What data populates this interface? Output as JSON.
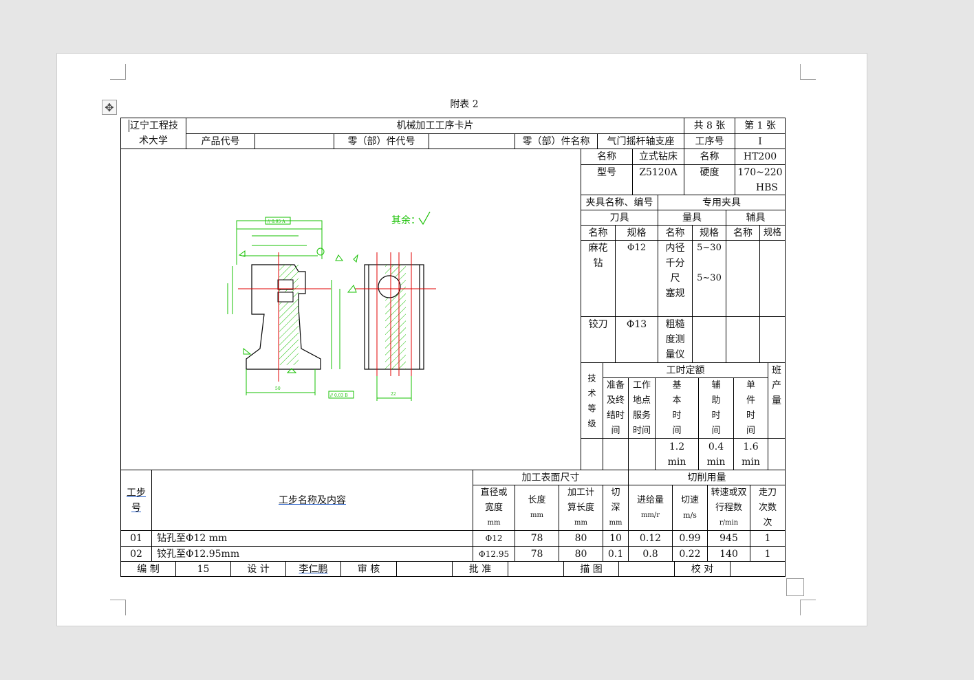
{
  "document": {
    "caption": "附表 2",
    "school": [
      "辽宁工程技",
      "术大学"
    ],
    "card_title": "机械加工工序卡片",
    "sheet_total": "共 8 张",
    "sheet_no": "第 1 张",
    "product_code_label": "产品代号",
    "product_code_value": "",
    "part_code_label": "零（部）件代号",
    "part_code_value": "",
    "part_name_label": "零（部）件名称",
    "part_name_value": "气门摇杆轴支座",
    "process_no_label": "工序号",
    "process_no_value": "I"
  },
  "machine": {
    "name_label": "名称",
    "name_value": "立式钻床",
    "model_label": "型号",
    "model_value": "Z5120A"
  },
  "material": {
    "name_label": "名称",
    "name_value": "HT200",
    "hardness_label": "硬度",
    "hardness_value": [
      "170~220",
      "HBS"
    ]
  },
  "fixture": {
    "label": "夹具名称、编号",
    "value": "专用夹具"
  },
  "tools": {
    "cutter": "刀具",
    "gauge": "量具",
    "aux": "辅具",
    "name": "名称",
    "spec": "规格",
    "spec_aux": "规格",
    "rows": [
      {
        "cutter_name": [
          "麻花",
          "钻"
        ],
        "cutter_spec": "Φ12",
        "gauge_name": [
          "内径",
          "千分",
          "尺",
          "塞规"
        ],
        "gauge_spec": [
          "5~30",
          "",
          "5~30"
        ]
      },
      {
        "cutter_name": [
          "铰刀"
        ],
        "cutter_spec": "Φ13",
        "gauge_name": [
          "粗糙",
          "度测",
          "量仪"
        ],
        "gauge_spec": []
      }
    ]
  },
  "time": {
    "tech_grade": [
      "技",
      "术",
      "等",
      "级"
    ],
    "quota": "工时定额",
    "output": [
      "班",
      "产",
      "量"
    ],
    "prep": [
      "准备",
      "及终",
      "结时",
      "间"
    ],
    "service": [
      "工作",
      "地点",
      "服务",
      "时间"
    ],
    "basic": [
      "基",
      "本",
      "时",
      "间"
    ],
    "auxiliary": [
      "辅",
      "助",
      "时",
      "间"
    ],
    "unit": [
      "单",
      "件",
      "时",
      "间"
    ],
    "basic_value": [
      "1.2",
      "min"
    ],
    "aux_value": [
      "0.4",
      "min"
    ],
    "unit_value": [
      "1.6",
      "min"
    ]
  },
  "drawing": {
    "rest": "其余：",
    "gdt1": "// 0.05 A",
    "gdt2": "// 0.03 B",
    "dim_bottom1": "50",
    "dim_bottom2": "22"
  },
  "steps": {
    "no_label": [
      "工步",
      "号"
    ],
    "content_label": "工步名称及内容",
    "surface_label": "加工表面尺寸",
    "cutting_label": "切削用量",
    "diameter_label": [
      "直径或",
      "宽度",
      "mm"
    ],
    "length_label": [
      "长度",
      "mm"
    ],
    "calc_length_label": [
      "加工计",
      "算长度",
      "mm"
    ],
    "depth_label": [
      "切",
      "深",
      "mm"
    ],
    "feed_label": [
      "进给量",
      "mm/r"
    ],
    "speed_label": [
      "切速",
      "m/s"
    ],
    "rpm_label": [
      "转速或双",
      "行程数",
      "r/min"
    ],
    "passes_label": [
      "走刀",
      "次数",
      "次"
    ],
    "rows": [
      {
        "no": "01",
        "content": "钻孔至Φ12 mm",
        "diameter": "Φ12",
        "length": "78",
        "calc_length": "80",
        "depth": "10",
        "feed": "0.12",
        "speed": "0.99",
        "rpm": "945",
        "passes": "1"
      },
      {
        "no": "02",
        "content": "铰孔至Φ12.95mm",
        "diameter": "Φ12.95",
        "length": "78",
        "calc_length": "80",
        "depth": "0.1",
        "feed": "0.8",
        "speed": "0.22",
        "rpm": "140",
        "passes": "1"
      }
    ]
  },
  "footer": {
    "compile_label": "编 制",
    "compile_value": "15",
    "design_label": "设 计",
    "design_value": "李仁鹏",
    "review_label": "审 核",
    "review_value": "",
    "approve_label": "批 准",
    "approve_value": "",
    "trace_label": "描 图",
    "trace_value": "",
    "check_label": "校 对",
    "check_value": ""
  },
  "colors": {
    "drawing_line": "#16c000",
    "center_line": "#e00000",
    "hatch": "#16c000"
  }
}
